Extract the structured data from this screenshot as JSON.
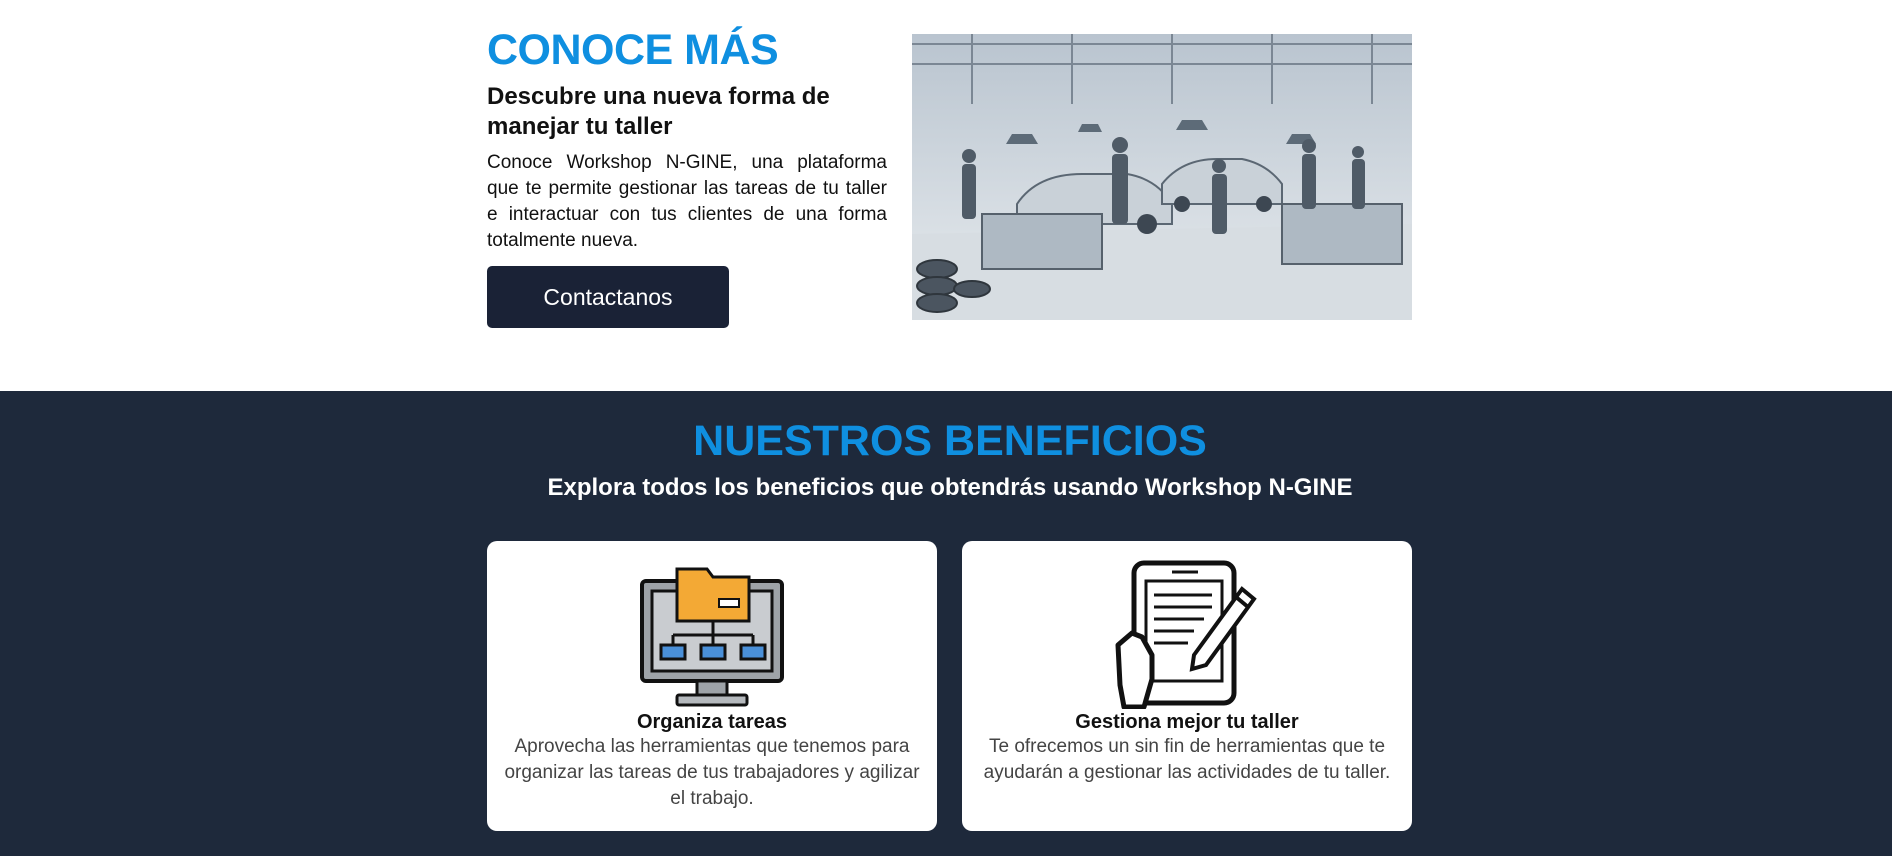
{
  "about": {
    "title": "CONOCE MÁS",
    "subtitle": "Descubre una nueva forma de manejar tu taller",
    "body": "Conoce Workshop N-GINE, una plataforma que te permite gestionar las tareas de tu taller e interactuar con tus clientes de una forma totalmente nueva.",
    "button_label": "Contactanos"
  },
  "benefits": {
    "title": "NUESTROS BENEFICIOS",
    "subtitle": "Explora todos los beneficios que obtendrás usando Workshop N-GINE",
    "cards": [
      {
        "icon": "folder-network-monitor-icon",
        "title": "Organiza tareas",
        "text": "Aprovecha las herramientas que tenemos para organizar las tareas de tus trabajadores y agilizar el trabajo."
      },
      {
        "icon": "tablet-pen-icon",
        "title": "Gestiona mejor tu taller",
        "text": "Te ofrecemos un sin fin de herramientas que te ayudarán a gestionar las actividades de tu taller."
      }
    ]
  },
  "colors": {
    "accent": "#0f8fe0",
    "dark_bg": "#1e293b",
    "button_bg": "#1a2236"
  }
}
